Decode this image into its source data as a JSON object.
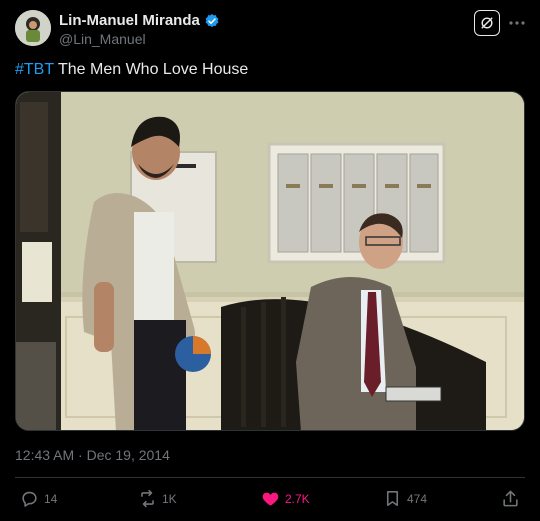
{
  "author": {
    "display_name": "Lin-Manuel Miranda",
    "handle": "@Lin_Manuel",
    "verified_icon": "verified-badge-icon",
    "avatar_icon": "avatar"
  },
  "tweet": {
    "hashtag": "#TBT",
    "text": " The Men Who Love House",
    "image_alt": "Two men in a hallway with mailboxes: one standing, one seated on a bench"
  },
  "meta": {
    "timestamp": "12:43 AM · Dec 19, 2014"
  },
  "actions": {
    "replies": "14",
    "reposts": "1K",
    "likes": "2.7K",
    "bookmarks": "474"
  },
  "colors": {
    "background": "#000000",
    "text": "#e7e9ea",
    "muted": "#71767b",
    "accent": "#1d9bf0",
    "like": "#f91880",
    "border": "#2f3336"
  }
}
